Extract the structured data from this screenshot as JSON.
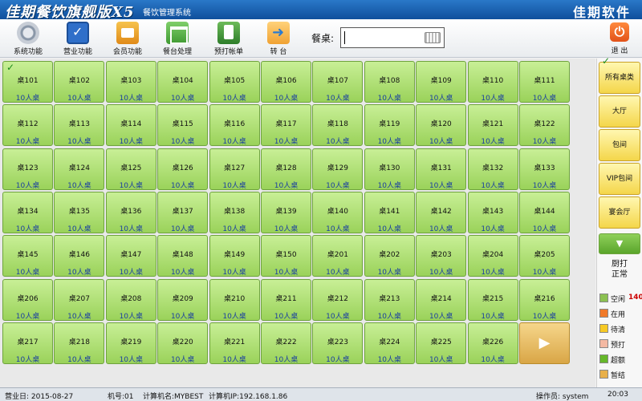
{
  "window": {
    "title": "佳期餐饮旗舰版X5",
    "subtitle": "餐饮管理系统",
    "brand": "佳期软件"
  },
  "toolbar": {
    "buttons": [
      {
        "label": "系统功能",
        "icon": "gear-icon"
      },
      {
        "label": "营业功能",
        "icon": "checkbox-icon"
      },
      {
        "label": "会员功能",
        "icon": "member-card-icon"
      },
      {
        "label": "餐台处理",
        "icon": "table-icon"
      },
      {
        "label": "预打帐单",
        "icon": "bill-icon"
      },
      {
        "label": "转 台",
        "icon": "transfer-table-icon"
      }
    ],
    "search_label": "餐桌:",
    "search_value": "",
    "exit_label": "退 出"
  },
  "tables": [
    {
      "name": "桌101",
      "capacity": "10人桌"
    },
    {
      "name": "桌102",
      "capacity": "10人桌"
    },
    {
      "name": "桌103",
      "capacity": "10人桌"
    },
    {
      "name": "桌104",
      "capacity": "10人桌"
    },
    {
      "name": "桌105",
      "capacity": "10人桌"
    },
    {
      "name": "桌106",
      "capacity": "10人桌"
    },
    {
      "name": "桌107",
      "capacity": "10人桌"
    },
    {
      "name": "桌108",
      "capacity": "10人桌"
    },
    {
      "name": "桌109",
      "capacity": "10人桌"
    },
    {
      "name": "桌110",
      "capacity": "10人桌"
    },
    {
      "name": "桌111",
      "capacity": "10人桌"
    },
    {
      "name": "桌112",
      "capacity": "10人桌"
    },
    {
      "name": "桌113",
      "capacity": "10人桌"
    },
    {
      "name": "桌114",
      "capacity": "10人桌"
    },
    {
      "name": "桌115",
      "capacity": "10人桌"
    },
    {
      "name": "桌116",
      "capacity": "10人桌"
    },
    {
      "name": "桌117",
      "capacity": "10人桌"
    },
    {
      "name": "桌118",
      "capacity": "10人桌"
    },
    {
      "name": "桌119",
      "capacity": "10人桌"
    },
    {
      "name": "桌120",
      "capacity": "10人桌"
    },
    {
      "name": "桌121",
      "capacity": "10人桌"
    },
    {
      "name": "桌122",
      "capacity": "10人桌"
    },
    {
      "name": "桌123",
      "capacity": "10人桌"
    },
    {
      "name": "桌124",
      "capacity": "10人桌"
    },
    {
      "name": "桌125",
      "capacity": "10人桌"
    },
    {
      "name": "桌126",
      "capacity": "10人桌"
    },
    {
      "name": "桌127",
      "capacity": "10人桌"
    },
    {
      "name": "桌128",
      "capacity": "10人桌"
    },
    {
      "name": "桌129",
      "capacity": "10人桌"
    },
    {
      "name": "桌130",
      "capacity": "10人桌"
    },
    {
      "name": "桌131",
      "capacity": "10人桌"
    },
    {
      "name": "桌132",
      "capacity": "10人桌"
    },
    {
      "name": "桌133",
      "capacity": "10人桌"
    },
    {
      "name": "桌134",
      "capacity": "10人桌"
    },
    {
      "name": "桌135",
      "capacity": "10人桌"
    },
    {
      "name": "桌136",
      "capacity": "10人桌"
    },
    {
      "name": "桌137",
      "capacity": "10人桌"
    },
    {
      "name": "桌138",
      "capacity": "10人桌"
    },
    {
      "name": "桌139",
      "capacity": "10人桌"
    },
    {
      "name": "桌140",
      "capacity": "10人桌"
    },
    {
      "name": "桌141",
      "capacity": "10人桌"
    },
    {
      "name": "桌142",
      "capacity": "10人桌"
    },
    {
      "name": "桌143",
      "capacity": "10人桌"
    },
    {
      "name": "桌144",
      "capacity": "10人桌"
    },
    {
      "name": "桌145",
      "capacity": "10人桌"
    },
    {
      "name": "桌146",
      "capacity": "10人桌"
    },
    {
      "name": "桌147",
      "capacity": "10人桌"
    },
    {
      "name": "桌148",
      "capacity": "10人桌"
    },
    {
      "name": "桌149",
      "capacity": "10人桌"
    },
    {
      "name": "桌150",
      "capacity": "10人桌"
    },
    {
      "name": "桌201",
      "capacity": "10人桌"
    },
    {
      "name": "桌202",
      "capacity": "10人桌"
    },
    {
      "name": "桌203",
      "capacity": "10人桌"
    },
    {
      "name": "桌204",
      "capacity": "10人桌"
    },
    {
      "name": "桌205",
      "capacity": "10人桌"
    },
    {
      "name": "桌206",
      "capacity": "10人桌"
    },
    {
      "name": "桌207",
      "capacity": "10人桌"
    },
    {
      "name": "桌208",
      "capacity": "10人桌"
    },
    {
      "name": "桌209",
      "capacity": "10人桌"
    },
    {
      "name": "桌210",
      "capacity": "10人桌"
    },
    {
      "name": "桌211",
      "capacity": "10人桌"
    },
    {
      "name": "桌212",
      "capacity": "10人桌"
    },
    {
      "name": "桌213",
      "capacity": "10人桌"
    },
    {
      "name": "桌214",
      "capacity": "10人桌"
    },
    {
      "name": "桌215",
      "capacity": "10人桌"
    },
    {
      "name": "桌216",
      "capacity": "10人桌"
    },
    {
      "name": "桌217",
      "capacity": "10人桌"
    },
    {
      "name": "桌218",
      "capacity": "10人桌"
    },
    {
      "name": "桌219",
      "capacity": "10人桌"
    },
    {
      "name": "桌220",
      "capacity": "10人桌"
    },
    {
      "name": "桌221",
      "capacity": "10人桌"
    },
    {
      "name": "桌222",
      "capacity": "10人桌"
    },
    {
      "name": "桌223",
      "capacity": "10人桌"
    },
    {
      "name": "桌224",
      "capacity": "10人桌"
    },
    {
      "name": "桌225",
      "capacity": "10人桌"
    },
    {
      "name": "桌226",
      "capacity": "10人桌"
    }
  ],
  "selected_table": "桌101",
  "next_page_icon": "arrow-right-icon",
  "sidebar": {
    "categories": [
      "所有桌类",
      "大厅",
      "包间",
      "VIP包间",
      "宴会厅"
    ],
    "selected_category": "所有桌类",
    "scroll_icon": "arrow-down-icon",
    "print_status_line1": "厨打",
    "print_status_line2": "正常",
    "legend": [
      {
        "label": "空闲",
        "count": "140",
        "color": "#8cc152"
      },
      {
        "label": "在用",
        "count": "",
        "color": "#f07a2a"
      },
      {
        "label": "待清",
        "count": "",
        "color": "#f6c925"
      },
      {
        "label": "预打",
        "count": "",
        "color": "#f4b9a3"
      },
      {
        "label": "超额",
        "count": "",
        "color": "#66b82a"
      },
      {
        "label": "暂结",
        "count": "",
        "color": "#e8b04a"
      }
    ]
  },
  "statusbar": {
    "date": "营业日: 2015-08-27",
    "machine_no": "机号:01",
    "machine_name": "计算机名:MYBEST",
    "ip": "计算机IP:192.168.1.86",
    "operator": "操作员: system",
    "time": "20:03"
  }
}
